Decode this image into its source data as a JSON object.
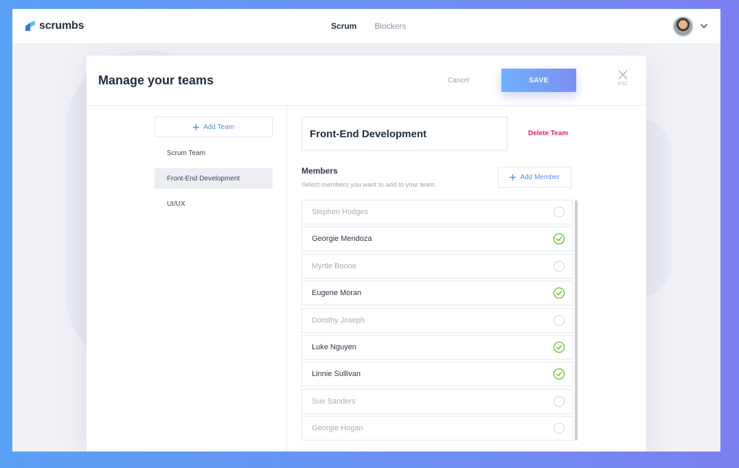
{
  "app": {
    "brand": "scrumbs"
  },
  "nav": {
    "items": [
      {
        "label": "Scrum",
        "active": true
      },
      {
        "label": "Blockers",
        "active": false
      }
    ]
  },
  "modal": {
    "title": "Manage your teams",
    "cancel_label": "Cancel",
    "save_label": "SAVE",
    "esc_label": "ESC"
  },
  "teams": {
    "add_label": "Add Team",
    "items": [
      {
        "label": "Scrum Team",
        "selected": false
      },
      {
        "label": "Front-End Development",
        "selected": true
      },
      {
        "label": "UI/UX",
        "selected": false
      }
    ]
  },
  "team_detail": {
    "name": "Front-End Development",
    "delete_label": "Delete Team",
    "members_title": "Members",
    "members_subtitle": "Select members you want to add to your team.",
    "add_member_label": "Add Member"
  },
  "members": [
    {
      "name": "Stephen Hodges",
      "checked": false
    },
    {
      "name": "Georgie Mendoza",
      "checked": true
    },
    {
      "name": "Myrtle Boone",
      "checked": false
    },
    {
      "name": "Eugene Moran",
      "checked": true
    },
    {
      "name": "Dorothy Joseph",
      "checked": false
    },
    {
      "name": "Luke Nguyen",
      "checked": true
    },
    {
      "name": "Linnie Sullivan",
      "checked": true
    },
    {
      "name": "Sue Sanders",
      "checked": false
    },
    {
      "name": "Georgie Hogan",
      "checked": false
    }
  ],
  "colors": {
    "accent": "#5a8fe8",
    "danger": "#d9285f",
    "check": "#7ac943",
    "save_gradient_start": "#6fb1fb",
    "save_gradient_end": "#7d8ff5"
  },
  "icons": {
    "logo": "scrumbs-logo-icon",
    "plus": "plus-icon",
    "close": "close-icon",
    "caret": "chevron-down-icon",
    "check": "check-circle-icon",
    "unchecked": "empty-circle-icon"
  }
}
